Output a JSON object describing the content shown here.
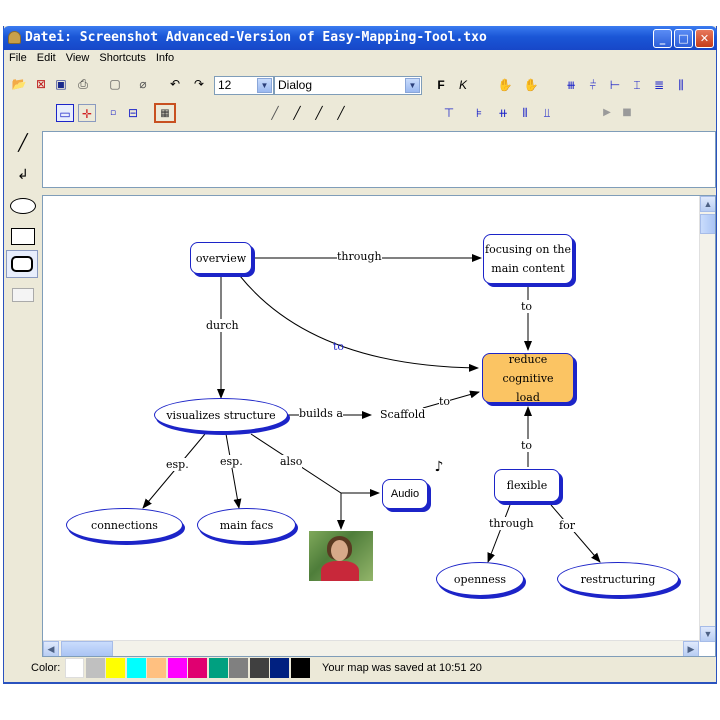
{
  "window": {
    "title": "Datei: Screenshot Advanced-Version of Easy-Mapping-Tool.txo"
  },
  "menu": [
    "File",
    "Edit",
    "View",
    "Shortcuts",
    "Info"
  ],
  "toolbar": {
    "font_size": "12",
    "font_name": "Dialog",
    "bold_label": "F",
    "italic_label": "K"
  },
  "map": {
    "nodes": {
      "overview": "overview",
      "focusing_1": "focusing on the",
      "focusing_2": "main content",
      "reduce_1": "reduce cognitive",
      "reduce_2": "load",
      "visualizes": "visualizes structure",
      "scaffold": "Scaffold",
      "audio": "Audio",
      "flexible": "flexible",
      "connections": "connections",
      "main_facs": "main facs",
      "openness": "openness",
      "restructuring": "restructuring"
    },
    "links": {
      "through_top": "through",
      "to_focus": "to",
      "durch": "durch",
      "to_curve": "to",
      "builds": "builds a",
      "to_scaffold": "to",
      "to_flexible": "to",
      "esp1": "esp.",
      "esp2": "esp.",
      "also": "also",
      "through_flex": "through",
      "for": "for"
    }
  },
  "colors": {
    "highlight_node": "#fbc463",
    "node_border": "#1c24c8",
    "palette": [
      "#ffffff",
      "#c0c0c0",
      "#ffff00",
      "#00ffff",
      "#ffc080",
      "#ff00ff",
      "#e00070",
      "#00a080",
      "#808080",
      "#404040",
      "#002080",
      "#000000"
    ]
  },
  "status": {
    "color_label": "Color:",
    "message": "Your map was saved at 10:51 20"
  }
}
